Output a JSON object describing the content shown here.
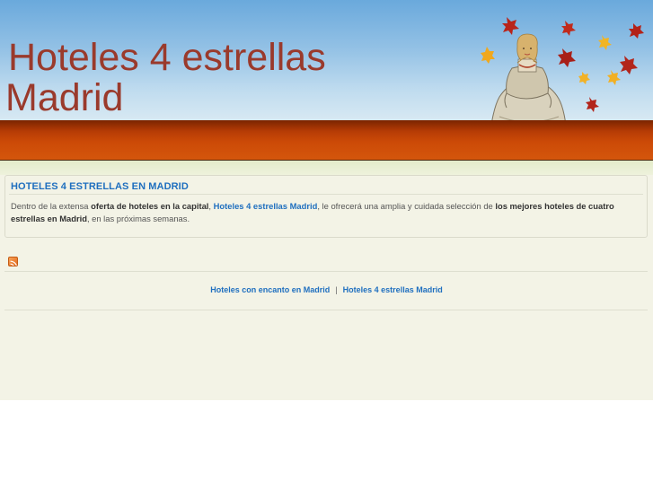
{
  "header": {
    "title_line1": "Hoteles 4 estrellas",
    "title_line2": "Madrid",
    "illustration_icon": "infanta-painting-with-autumn-leaves-icon"
  },
  "post": {
    "title": "HOTELES 4 ESTRELLAS EN MADRID",
    "body": {
      "t1": "Dentro de la extensa ",
      "b1": "oferta de hoteles en la capital",
      "t2": ", ",
      "link1": "Hoteles 4 estrellas Madrid",
      "t3": ", le ofrecerá una amplia y cuidada selección de ",
      "b2": "los mejores hoteles de cuatro estrellas en Madrid",
      "t4": ", en las próximas semanas."
    }
  },
  "feed": {
    "icon": "rss-feed-icon"
  },
  "footer": {
    "link1": "Hoteles con encanto en Madrid",
    "separator": "|",
    "link2": "Hoteles 4 estrellas Madrid"
  },
  "colors": {
    "title": "#9a3a2c",
    "link": "#1f6fbf",
    "band": "#cc4a07",
    "content_bg": "#f3f3e6"
  }
}
